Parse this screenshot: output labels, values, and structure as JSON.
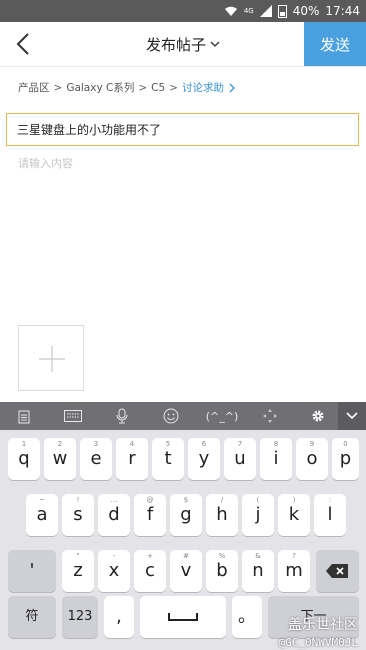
{
  "status_bar": {
    "network_label": "4G",
    "battery": "40%",
    "time": "17:44"
  },
  "header": {
    "title": "发布帖子",
    "send_label": "发送"
  },
  "breadcrumb": {
    "items": [
      "产品区",
      "Galaxy C系列",
      "C5"
    ],
    "current": "讨论求助",
    "separator": ">"
  },
  "form": {
    "title_value": "三星键盘上的小功能用不了",
    "content_placeholder": "请输入内容"
  },
  "keyboard": {
    "toolbar": {
      "emoticon_label": "(^_^)"
    },
    "row1": [
      {
        "ch": "q",
        "hint": "1"
      },
      {
        "ch": "w",
        "hint": "2"
      },
      {
        "ch": "e",
        "hint": "3"
      },
      {
        "ch": "r",
        "hint": "4"
      },
      {
        "ch": "t",
        "hint": "5"
      },
      {
        "ch": "y",
        "hint": "6"
      },
      {
        "ch": "u",
        "hint": "7"
      },
      {
        "ch": "i",
        "hint": "8"
      },
      {
        "ch": "o",
        "hint": "9"
      },
      {
        "ch": "p",
        "hint": "0"
      }
    ],
    "row2": [
      {
        "ch": "a",
        "hint": "~"
      },
      {
        "ch": "s",
        "hint": "!"
      },
      {
        "ch": "d",
        "hint": "…"
      },
      {
        "ch": "f",
        "hint": "@"
      },
      {
        "ch": "g",
        "hint": "$"
      },
      {
        "ch": "h",
        "hint": "/"
      },
      {
        "ch": "j",
        "hint": "("
      },
      {
        "ch": "k",
        "hint": ")"
      },
      {
        "ch": "l",
        "hint": ":"
      }
    ],
    "row3": [
      {
        "ch": "'",
        "hint": ""
      },
      {
        "ch": "z",
        "hint": "\""
      },
      {
        "ch": "x",
        "hint": "-"
      },
      {
        "ch": "c",
        "hint": "+"
      },
      {
        "ch": "v",
        "hint": "#"
      },
      {
        "ch": "b",
        "hint": "%"
      },
      {
        "ch": "n",
        "hint": "&"
      },
      {
        "ch": "m",
        "hint": "?"
      }
    ],
    "symbol_label": "符",
    "numbers_label": "123",
    "comma_label": ",",
    "period_label": "。",
    "enter_label": "下一"
  },
  "watermark": {
    "brand": "盖乐世社区",
    "user": "@GC_0NWVM0JL"
  },
  "colors": {
    "accent": "#4aa0de",
    "breadcrumb_active": "#3a93d6",
    "input_border": "#e4b65a"
  }
}
